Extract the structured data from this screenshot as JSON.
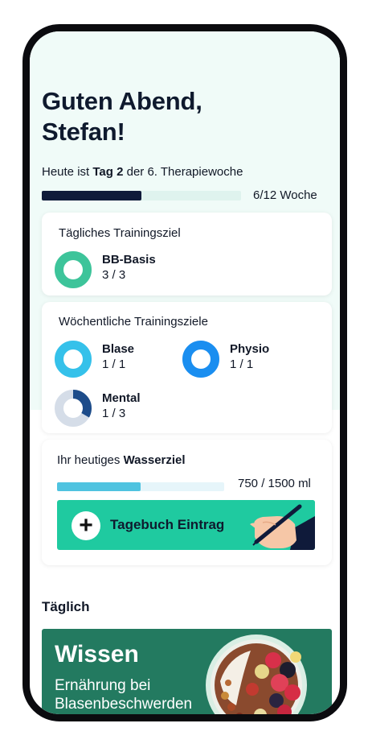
{
  "greeting": {
    "line1": "Guten Abend,",
    "line2": "Stefan!"
  },
  "therapy": {
    "prefix": "Heute ist ",
    "day": "Tag 2",
    "suffix": " der 6. Therapiewoche",
    "week_label": "6/12 Woche",
    "progress": 0.5
  },
  "daily_goal": {
    "title": "Tägliches Trainingsziel",
    "items": [
      {
        "name": "BB-Basis",
        "count": "3 / 3",
        "progress": 1.0,
        "color": "#3dc49a",
        "track": "#e7f7f1"
      }
    ]
  },
  "weekly_goals": {
    "title": "Wöchentliche Trainingsziele",
    "items": [
      {
        "name": "Blase",
        "count": "1 / 1",
        "progress": 1.0,
        "color": "#35c1ea",
        "track": "#e4f6fc"
      },
      {
        "name": "Physio",
        "count": "1 / 1",
        "progress": 1.0,
        "color": "#1a8ef0",
        "track": "#e3f0fd"
      },
      {
        "name": "Mental",
        "count": "1 / 3",
        "progress": 0.333,
        "color": "#1d4c8a",
        "track": "#d5dde8"
      }
    ]
  },
  "water": {
    "prefix": "Ihr heutiges ",
    "highlight": "Wasserziel",
    "amount": "750 / 1500 ml",
    "progress": 0.5,
    "button_label": "Tagebuch Eintrag"
  },
  "daily_section": {
    "title": "Täglich",
    "card": {
      "title": "Wissen",
      "subtitle": "Ernährung bei Blasenbeschwerden"
    }
  },
  "colors": {
    "accent": "#1fcaa0",
    "hero_bg": "#f0fbf8",
    "knowledge_bg": "#237a60",
    "navy": "#0f1a3a"
  },
  "icons": [
    "plus-icon",
    "pen-hand-icon",
    "bowl-image"
  ]
}
